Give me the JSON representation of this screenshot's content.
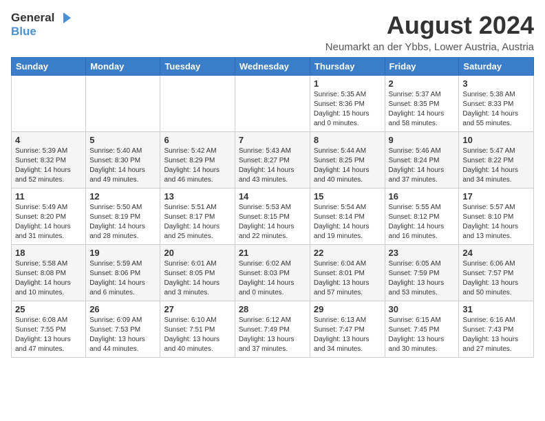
{
  "header": {
    "logo_general": "General",
    "logo_blue": "Blue",
    "month_year": "August 2024",
    "location": "Neumarkt an der Ybbs, Lower Austria, Austria"
  },
  "weekdays": [
    "Sunday",
    "Monday",
    "Tuesday",
    "Wednesday",
    "Thursday",
    "Friday",
    "Saturday"
  ],
  "weeks": [
    [
      {
        "day": "",
        "info": ""
      },
      {
        "day": "",
        "info": ""
      },
      {
        "day": "",
        "info": ""
      },
      {
        "day": "",
        "info": ""
      },
      {
        "day": "1",
        "info": "Sunrise: 5:35 AM\nSunset: 8:36 PM\nDaylight: 15 hours\nand 0 minutes."
      },
      {
        "day": "2",
        "info": "Sunrise: 5:37 AM\nSunset: 8:35 PM\nDaylight: 14 hours\nand 58 minutes."
      },
      {
        "day": "3",
        "info": "Sunrise: 5:38 AM\nSunset: 8:33 PM\nDaylight: 14 hours\nand 55 minutes."
      }
    ],
    [
      {
        "day": "4",
        "info": "Sunrise: 5:39 AM\nSunset: 8:32 PM\nDaylight: 14 hours\nand 52 minutes."
      },
      {
        "day": "5",
        "info": "Sunrise: 5:40 AM\nSunset: 8:30 PM\nDaylight: 14 hours\nand 49 minutes."
      },
      {
        "day": "6",
        "info": "Sunrise: 5:42 AM\nSunset: 8:29 PM\nDaylight: 14 hours\nand 46 minutes."
      },
      {
        "day": "7",
        "info": "Sunrise: 5:43 AM\nSunset: 8:27 PM\nDaylight: 14 hours\nand 43 minutes."
      },
      {
        "day": "8",
        "info": "Sunrise: 5:44 AM\nSunset: 8:25 PM\nDaylight: 14 hours\nand 40 minutes."
      },
      {
        "day": "9",
        "info": "Sunrise: 5:46 AM\nSunset: 8:24 PM\nDaylight: 14 hours\nand 37 minutes."
      },
      {
        "day": "10",
        "info": "Sunrise: 5:47 AM\nSunset: 8:22 PM\nDaylight: 14 hours\nand 34 minutes."
      }
    ],
    [
      {
        "day": "11",
        "info": "Sunrise: 5:49 AM\nSunset: 8:20 PM\nDaylight: 14 hours\nand 31 minutes."
      },
      {
        "day": "12",
        "info": "Sunrise: 5:50 AM\nSunset: 8:19 PM\nDaylight: 14 hours\nand 28 minutes."
      },
      {
        "day": "13",
        "info": "Sunrise: 5:51 AM\nSunset: 8:17 PM\nDaylight: 14 hours\nand 25 minutes."
      },
      {
        "day": "14",
        "info": "Sunrise: 5:53 AM\nSunset: 8:15 PM\nDaylight: 14 hours\nand 22 minutes."
      },
      {
        "day": "15",
        "info": "Sunrise: 5:54 AM\nSunset: 8:14 PM\nDaylight: 14 hours\nand 19 minutes."
      },
      {
        "day": "16",
        "info": "Sunrise: 5:55 AM\nSunset: 8:12 PM\nDaylight: 14 hours\nand 16 minutes."
      },
      {
        "day": "17",
        "info": "Sunrise: 5:57 AM\nSunset: 8:10 PM\nDaylight: 14 hours\nand 13 minutes."
      }
    ],
    [
      {
        "day": "18",
        "info": "Sunrise: 5:58 AM\nSunset: 8:08 PM\nDaylight: 14 hours\nand 10 minutes."
      },
      {
        "day": "19",
        "info": "Sunrise: 5:59 AM\nSunset: 8:06 PM\nDaylight: 14 hours\nand 6 minutes."
      },
      {
        "day": "20",
        "info": "Sunrise: 6:01 AM\nSunset: 8:05 PM\nDaylight: 14 hours\nand 3 minutes."
      },
      {
        "day": "21",
        "info": "Sunrise: 6:02 AM\nSunset: 8:03 PM\nDaylight: 14 hours\nand 0 minutes."
      },
      {
        "day": "22",
        "info": "Sunrise: 6:04 AM\nSunset: 8:01 PM\nDaylight: 13 hours\nand 57 minutes."
      },
      {
        "day": "23",
        "info": "Sunrise: 6:05 AM\nSunset: 7:59 PM\nDaylight: 13 hours\nand 53 minutes."
      },
      {
        "day": "24",
        "info": "Sunrise: 6:06 AM\nSunset: 7:57 PM\nDaylight: 13 hours\nand 50 minutes."
      }
    ],
    [
      {
        "day": "25",
        "info": "Sunrise: 6:08 AM\nSunset: 7:55 PM\nDaylight: 13 hours\nand 47 minutes."
      },
      {
        "day": "26",
        "info": "Sunrise: 6:09 AM\nSunset: 7:53 PM\nDaylight: 13 hours\nand 44 minutes."
      },
      {
        "day": "27",
        "info": "Sunrise: 6:10 AM\nSunset: 7:51 PM\nDaylight: 13 hours\nand 40 minutes."
      },
      {
        "day": "28",
        "info": "Sunrise: 6:12 AM\nSunset: 7:49 PM\nDaylight: 13 hours\nand 37 minutes."
      },
      {
        "day": "29",
        "info": "Sunrise: 6:13 AM\nSunset: 7:47 PM\nDaylight: 13 hours\nand 34 minutes."
      },
      {
        "day": "30",
        "info": "Sunrise: 6:15 AM\nSunset: 7:45 PM\nDaylight: 13 hours\nand 30 minutes."
      },
      {
        "day": "31",
        "info": "Sunrise: 6:16 AM\nSunset: 7:43 PM\nDaylight: 13 hours\nand 27 minutes."
      }
    ]
  ]
}
